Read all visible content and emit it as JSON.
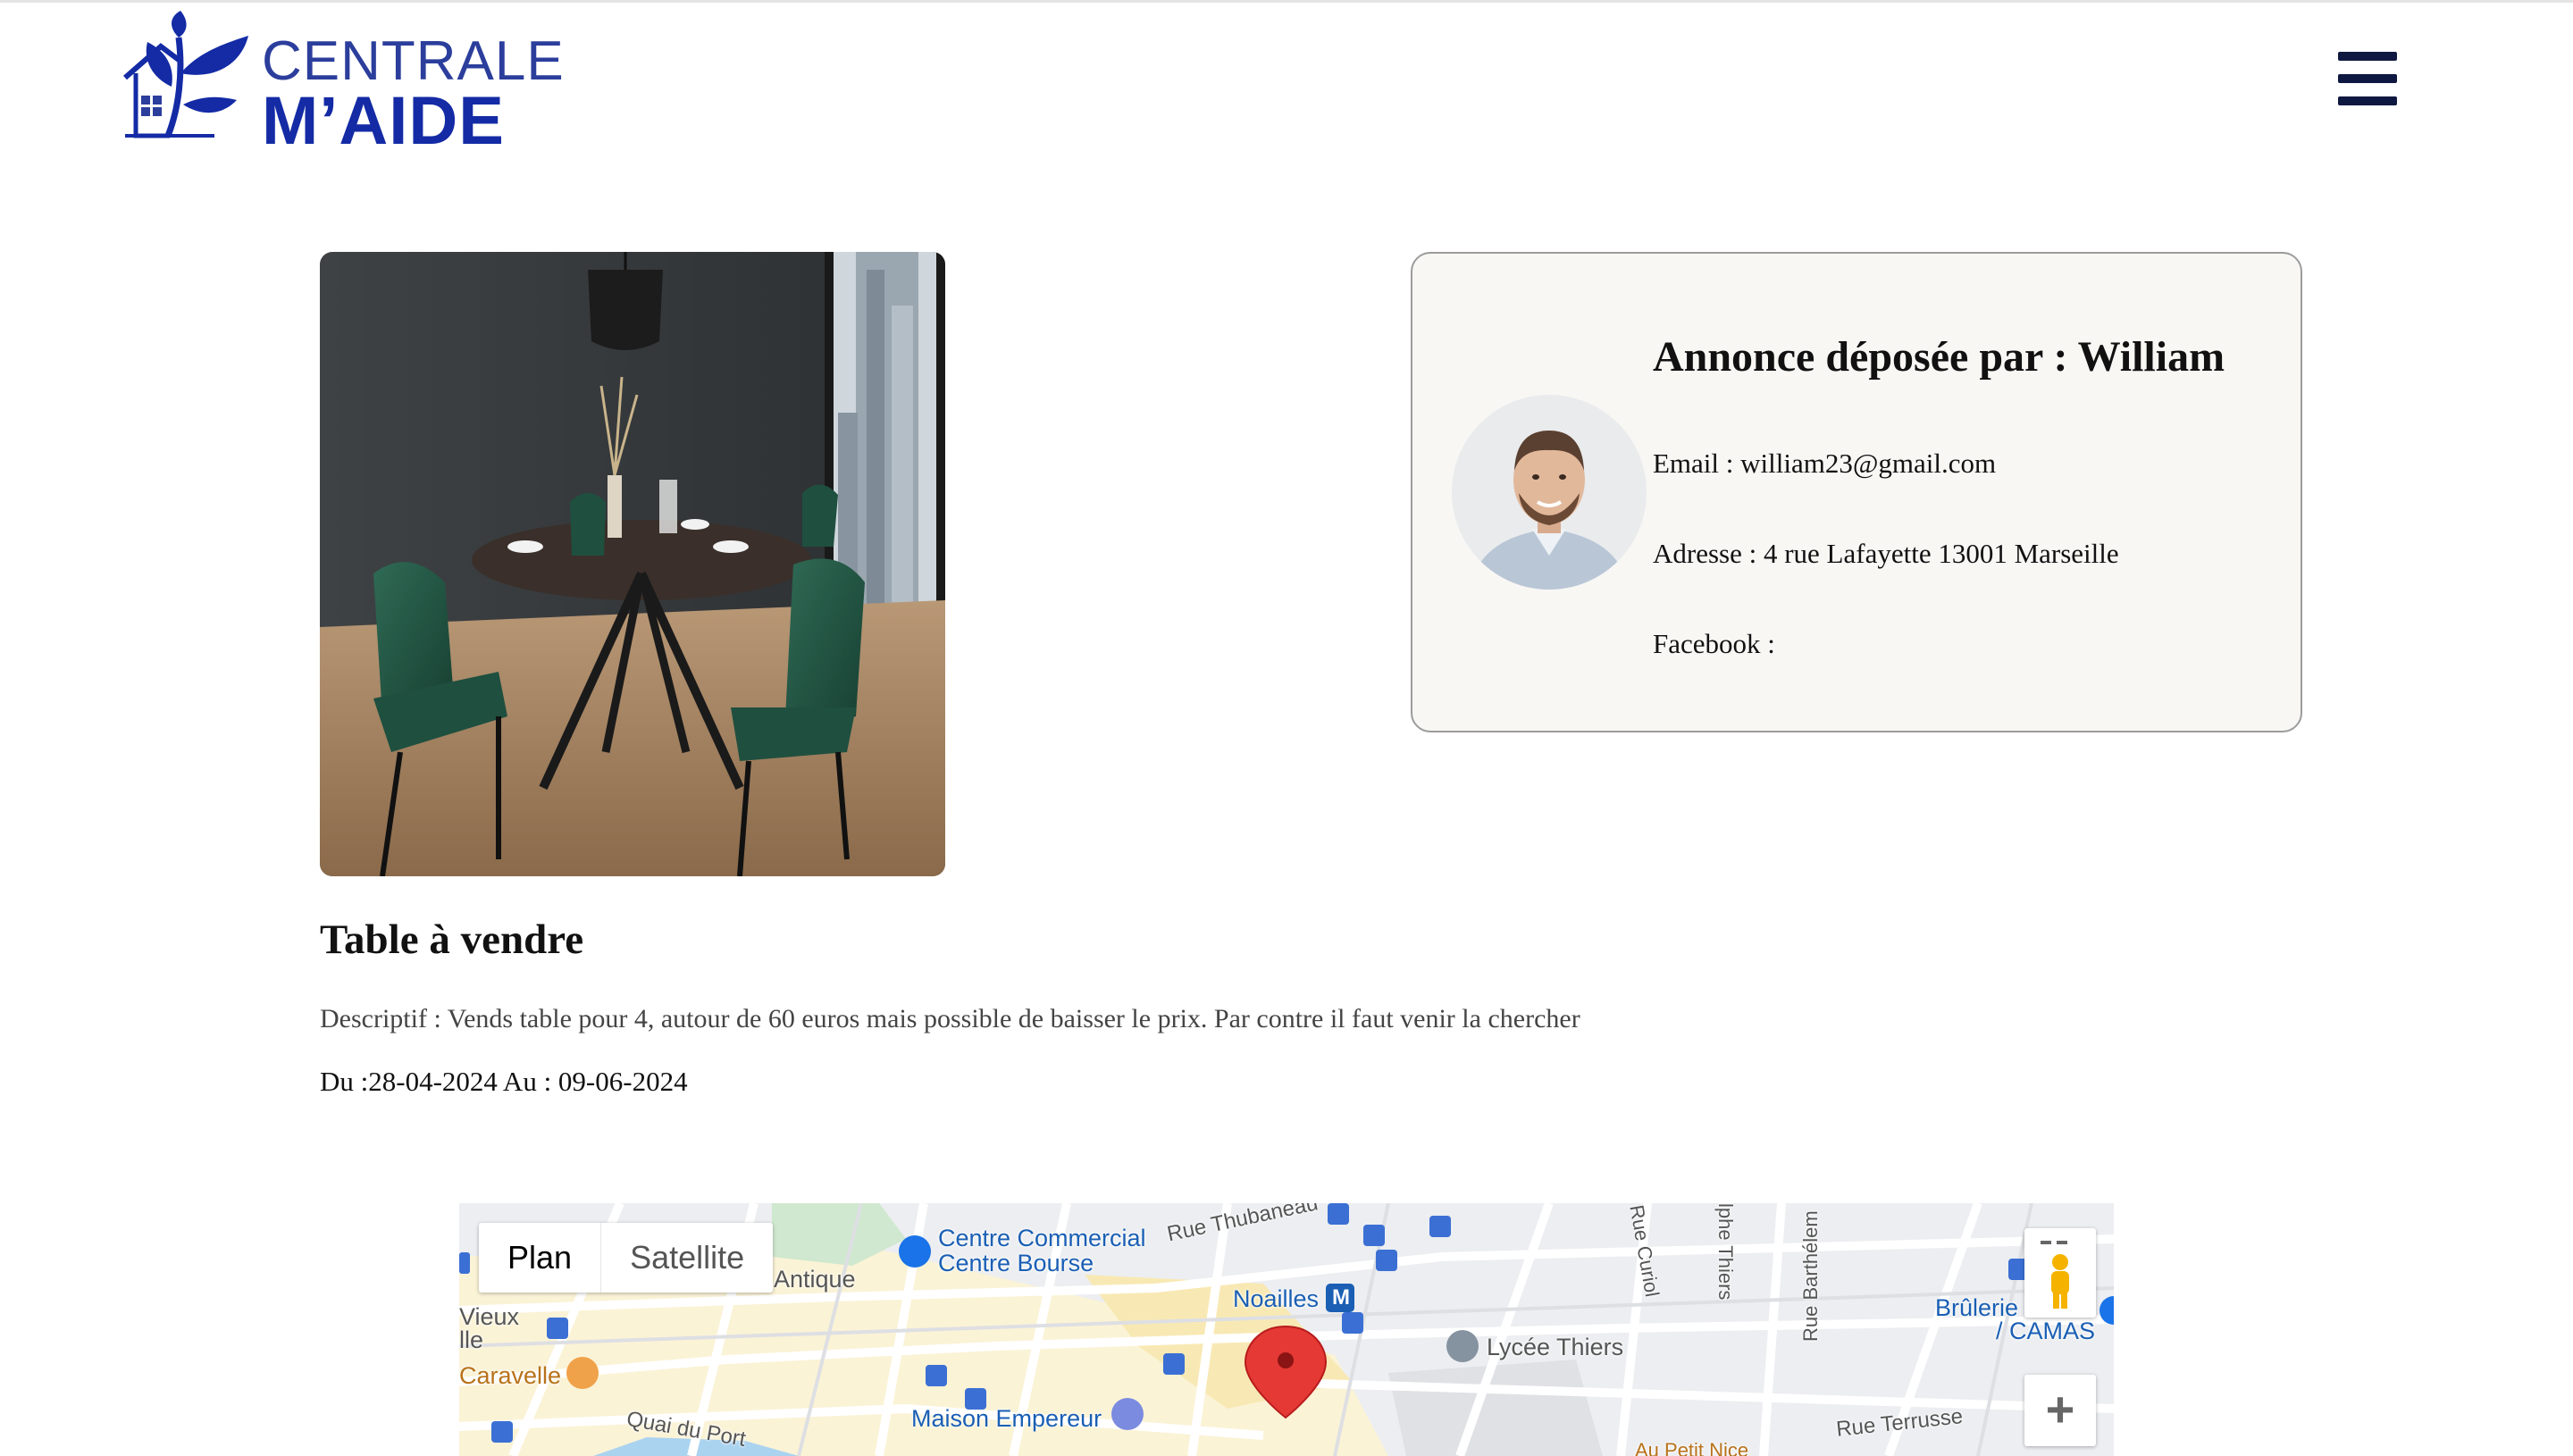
{
  "header": {
    "logo_line1": "CENTRALE",
    "logo_line2": "M’AIDE",
    "menu_icon": "hamburger-menu-icon"
  },
  "listing": {
    "photo": "dining-table-photo",
    "title": "Table à vendre",
    "description": "Descriptif : Vends table pour 4, autour de 60 euros mais possible de baisser le prix. Par contre il faut venir la chercher",
    "dates": "Du :28-04-2024 Au : 09-06-2024"
  },
  "seller": {
    "title": "Annonce déposée par : William",
    "email": "Email : william23@gmail.com",
    "address": "Adresse : 4 rue Lafayette 13001 Marseille",
    "facebook": "Facebook :"
  },
  "map": {
    "type_plan": "Plan",
    "type_satellite": "Satellite",
    "zoom_in": "+",
    "labels": {
      "centre_commercial": "Centre Commercial",
      "centre_bourse": "Centre Bourse",
      "rue_thubaneau": "Rue Thubaneau",
      "antique": "Antique",
      "vieux": "Vieux",
      "ile": "lle",
      "caravelle": "Caravelle",
      "quai_du_port": "Quai du Port",
      "noailles": "Noailles",
      "maison_empereur": "Maison Empereur",
      "lycee_thiers": "Lycée Thiers",
      "rue_curiol": "Rue Curiol",
      "alphe_thiers": "lphe Thiers",
      "rue_barthelemy": "Rue Barthélem",
      "brulerie": "Brûlerie",
      "camas": "/ CAMAS",
      "rue_terrusse": "Rue Terrusse",
      "au_petit_nice": "Au Petit Nice",
      "metro_badge": "M"
    },
    "colors": {
      "marker": "#e53935",
      "poi_blue": "#1a73e8"
    }
  },
  "colors": {
    "brand_dark": "#142ba5",
    "menu": "#0f1840"
  }
}
